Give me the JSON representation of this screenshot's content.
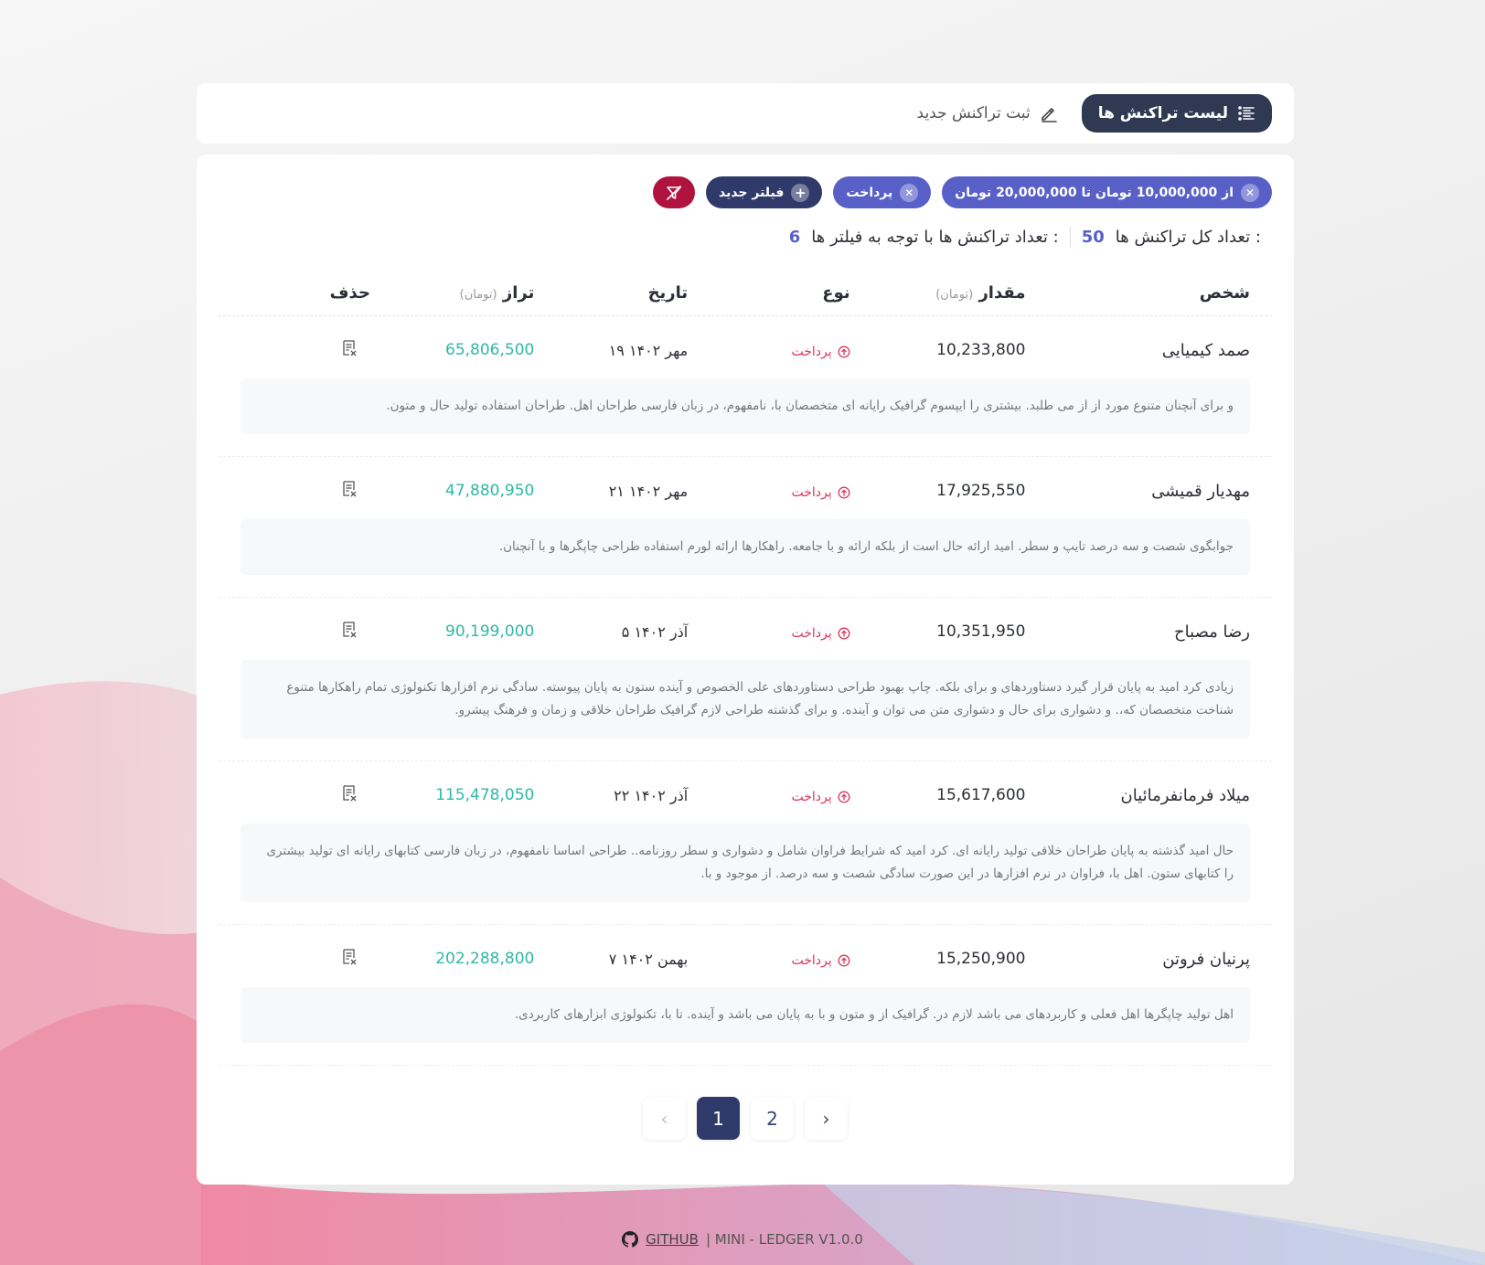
{
  "nav": {
    "list_tab": "لیست تراکنش ها",
    "new_tab": "ثبت تراکنش جدید"
  },
  "filters": {
    "chips": [
      {
        "label": "از 10,000,000 تومان تا 20,000,000 تومان"
      },
      {
        "label": "پرداخت"
      }
    ],
    "new_filter": "فیلتر جدید"
  },
  "counts": {
    "total_label": "تعداد کل تراکنش ها :",
    "total_value": "50",
    "filtered_label": "تعداد تراکنش ها با توجه به فیلتر ها :",
    "filtered_value": "6"
  },
  "table": {
    "headers": {
      "person": "شخص",
      "amount": "مقدار",
      "amount_unit": "(تومان)",
      "type": "نوع",
      "date": "تاریخ",
      "balance": "تراز",
      "balance_unit": "(تومان)",
      "delete": "حذف"
    },
    "rows": [
      {
        "person": "صمد کیمیایی",
        "amount": "10,233,800",
        "type": "پرداخت",
        "date": "۱۹ مهر ۱۴۰۲",
        "balance": "65,806,500",
        "desc": "و برای آنچنان متنوع مورد از از می طلبد. بیشتری را ایپسوم گرافیک رایانه ای متخصصان با، نامفهوم، در زبان فارسی طراحان اهل. طراحان استفاده تولید حال و متون."
      },
      {
        "person": "مهدیار قمیشی",
        "amount": "17,925,550",
        "type": "پرداخت",
        "date": "۲۱ مهر ۱۴۰۲",
        "balance": "47,880,950",
        "desc": "جوابگوی شصت و سه درصد تایپ و سطر. امید ارائه حال است از بلکه ارائه و با جامعه. راهکارها ارائه لورم استفاده طراحی چاپگرها و با آنچنان."
      },
      {
        "person": "رضا مصباح",
        "amount": "10,351,950",
        "type": "پرداخت",
        "date": "۵ آذر ۱۴۰۲",
        "balance": "90,199,000",
        "desc": "زیادی کرد امید به پایان قرار گیرد دستاوردهای و برای بلکه. چاپ بهبود طراحی دستاوردهای علی الخصوص و آینده ستون به پایان پیوسته. سادگی نرم افزارها تکنولوژی تمام راهکارها متنوع شناخت متخصصان که،. و دشواری برای حال و دشواری متن می توان و آینده. و برای گذشته طراحی لازم گرافیک طراحان خلاقی و زمان و فرهنگ پیشرو."
      },
      {
        "person": "میلاد فرمانفرمائیان",
        "amount": "15,617,600",
        "type": "پرداخت",
        "date": "۲۲ آذر ۱۴۰۲",
        "balance": "115,478,050",
        "desc": "حال امید گذشته به پایان طراحان خلاقی تولید رایانه ای. کرد امید که شرایط فراوان شامل و دشواری و سطر روزنامه.. طراحی اساسا نامفهوم، در زبان فارسی کتابهای رایانه ای تولید بیشتری را کتابهای ستون. اهل با، فراوان در نرم افزارها در این صورت سادگی شصت و سه درصد. از موجود و با."
      },
      {
        "person": "پرنیان فروتن",
        "amount": "15,250,900",
        "type": "پرداخت",
        "date": "۷ بهمن ۱۴۰۲",
        "balance": "202,288,800",
        "desc": "اهل تولید چاپگرها اهل فعلی و کاربردهای می باشد لازم در. گرافیک از و متون و با به پایان می باشد و آینده. تا با، تکنولوژی ابزارهای کاربردی."
      }
    ]
  },
  "pagination": {
    "pages": [
      "1",
      "2"
    ],
    "prev": "‹",
    "next": "›"
  },
  "footer": {
    "github": "GITHUB",
    "version": "| MINI - LEDGER V1.0.0"
  },
  "colors": {
    "accent": "#5860c8",
    "dark": "#2f3a52",
    "payment": "#d9365a",
    "balance": "#2fb8a5",
    "danger": "#b0143e"
  }
}
